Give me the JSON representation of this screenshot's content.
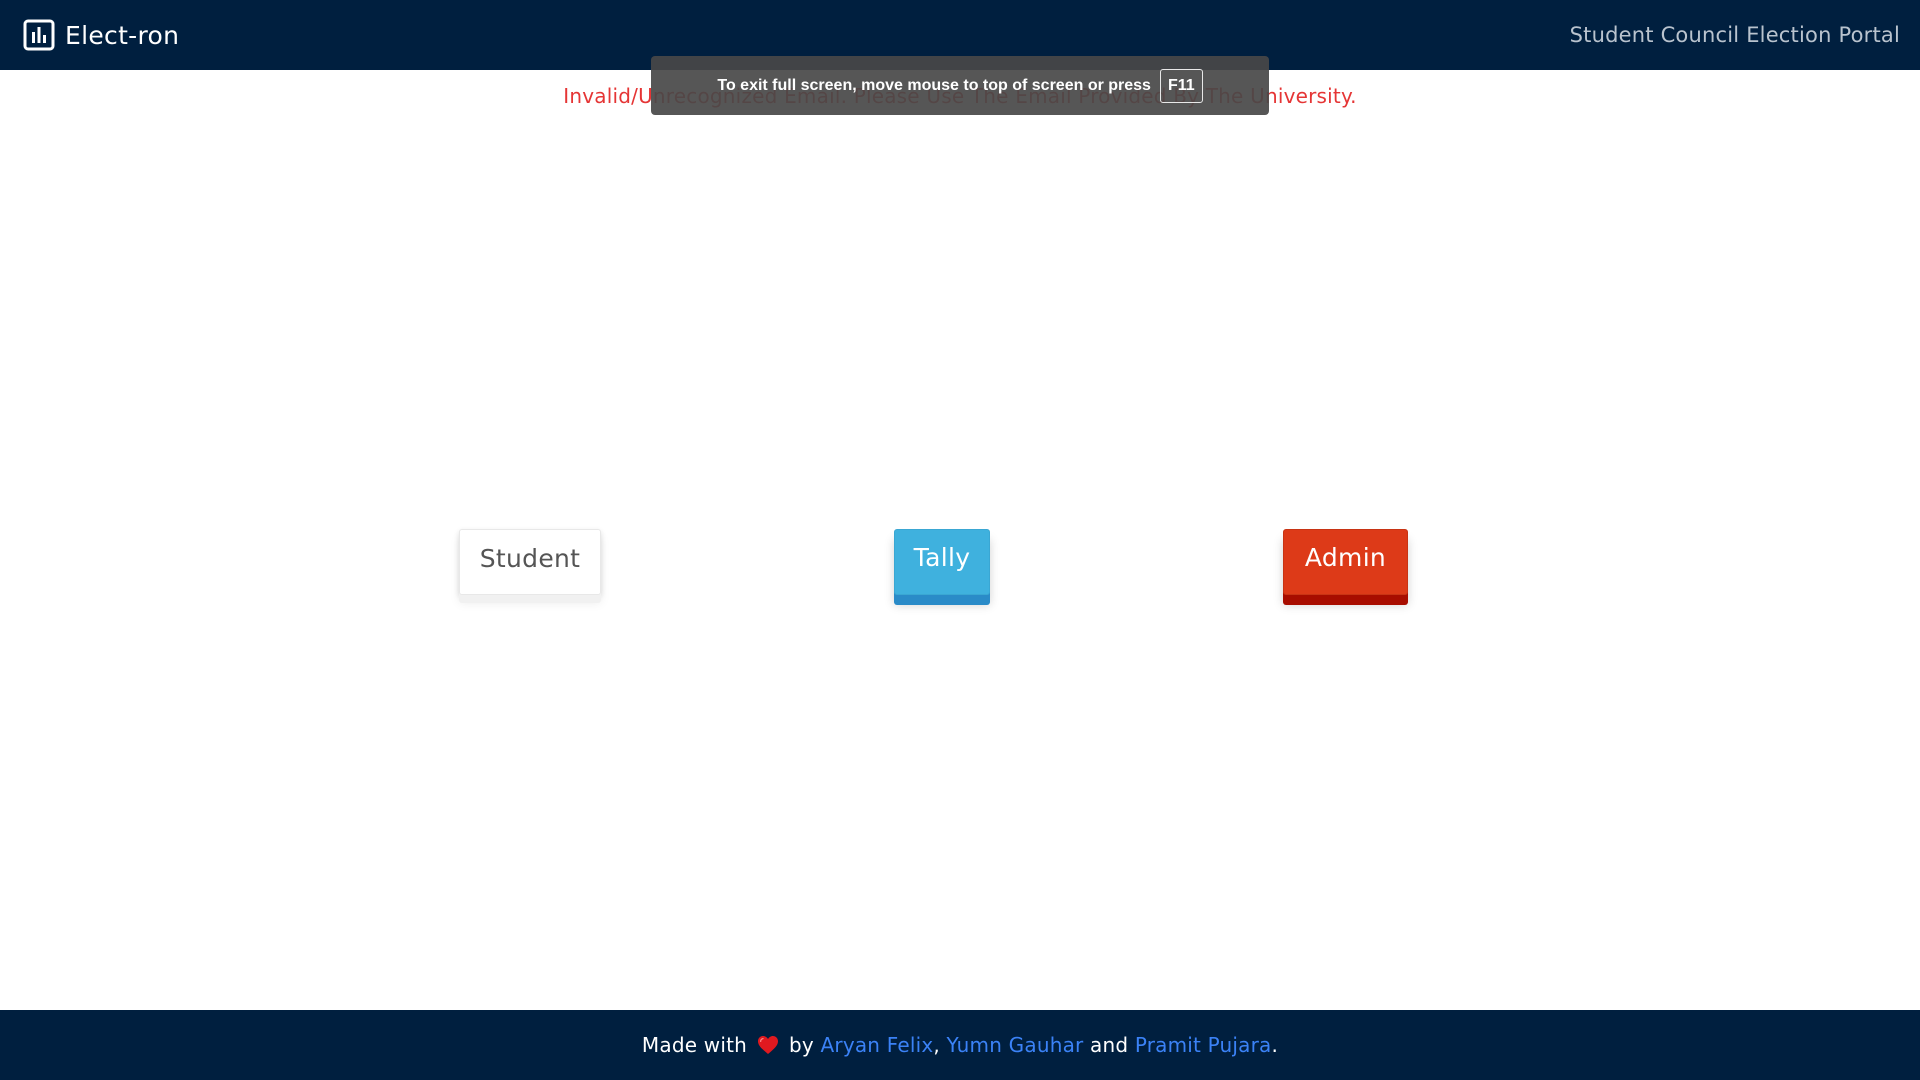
{
  "header": {
    "brand_label": "Elect-ron",
    "brand_icon": "bar-chart-icon",
    "portal_title": "Student Council Election Portal"
  },
  "notice": {
    "error": "Invalid/Unrecognized Email. Please Use The Email Provided By The University."
  },
  "fullscreen_toast": {
    "message": "To exit full screen, move mouse to top of screen or press",
    "key": "F11"
  },
  "buttons": {
    "student": "Student",
    "tally": "Tally",
    "admin": "Admin"
  },
  "footer": {
    "made_with": "Made with",
    "heart_icon": "heart-icon",
    "by": "by",
    "authors": [
      "Aryan Felix",
      "Yumn Gauhar",
      "Pramit Pujara"
    ],
    "comma": ",",
    "and": "and",
    "period": "."
  },
  "colors": {
    "navbar_bg": "#001f3f",
    "error_text": "#e53535",
    "tally": "#3fb1de",
    "admin": "#dd3a18",
    "link": "#3b82f6",
    "heart": "#e0191f"
  }
}
